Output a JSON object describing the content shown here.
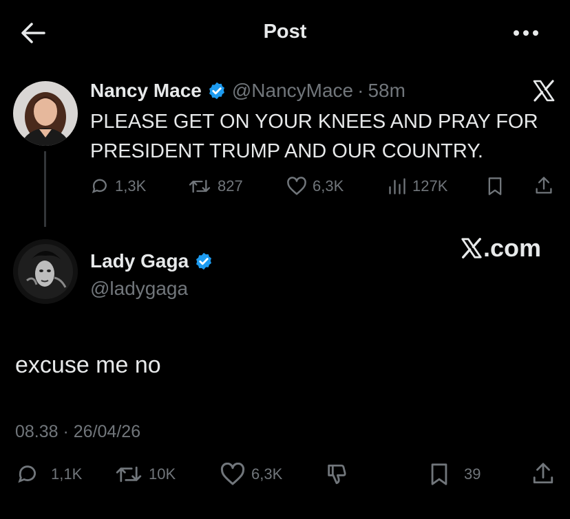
{
  "header": {
    "title": "Post",
    "back_icon": "arrow-left-icon",
    "more_icon": "more-dots-icon"
  },
  "colors": {
    "verified": "#1d9bf0",
    "muted": "#71767b",
    "text": "#e7e9ea",
    "background": "#000000"
  },
  "parent_post": {
    "display_name": "Nancy Mace",
    "handle": "@NancyMace",
    "separator": "·",
    "time": "58m",
    "text": "PLEASE GET ON YOUR KNEES AND PRAY FOR PRESIDENT TRUMP AND OUR COUNTRY.",
    "actions": {
      "replies": "1,3K",
      "reposts": "827",
      "likes": "6,3K",
      "views": "127K"
    }
  },
  "main_post": {
    "display_name": "Lady Gaga",
    "handle": "@ladygaga",
    "watermark": ".com",
    "text": "excuse me no",
    "timestamp": "08.38 · 26/04/26",
    "actions": {
      "replies": "1,1K",
      "reposts": "10K",
      "likes": "6,3K",
      "bookmarks": "39"
    }
  }
}
